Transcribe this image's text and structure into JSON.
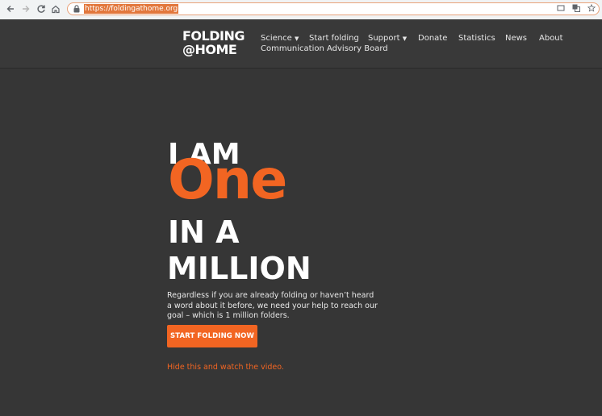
{
  "browser": {
    "url": "https://foldingathome.org",
    "icons": [
      "back-icon",
      "forward-icon",
      "reload-icon",
      "home-icon",
      "lock-icon",
      "cast-icon",
      "translate-icon",
      "star-icon"
    ]
  },
  "site": {
    "logo_line1": "FOLDING",
    "logo_line2": "@HOME",
    "nav": {
      "science": "Science",
      "start_folding": "Start folding",
      "support": "Support",
      "donate": "Donate",
      "statistics": "Statistics",
      "news": "News",
      "about": "About",
      "advisory_board": "Communication Advisory Board"
    }
  },
  "hero": {
    "line1": "I AM",
    "highlight": "One",
    "line2": "IN A",
    "line3": "MILLION",
    "description": "Regardless if you are already folding or haven’t heard a word about it before, we need your help to reach our goal – which is 1 million folders.",
    "cta_label": "START FOLDING NOW",
    "video_link": "Hide this and watch the video."
  },
  "colors": {
    "accent": "#f26522",
    "background": "#363636",
    "header": "#393939"
  }
}
